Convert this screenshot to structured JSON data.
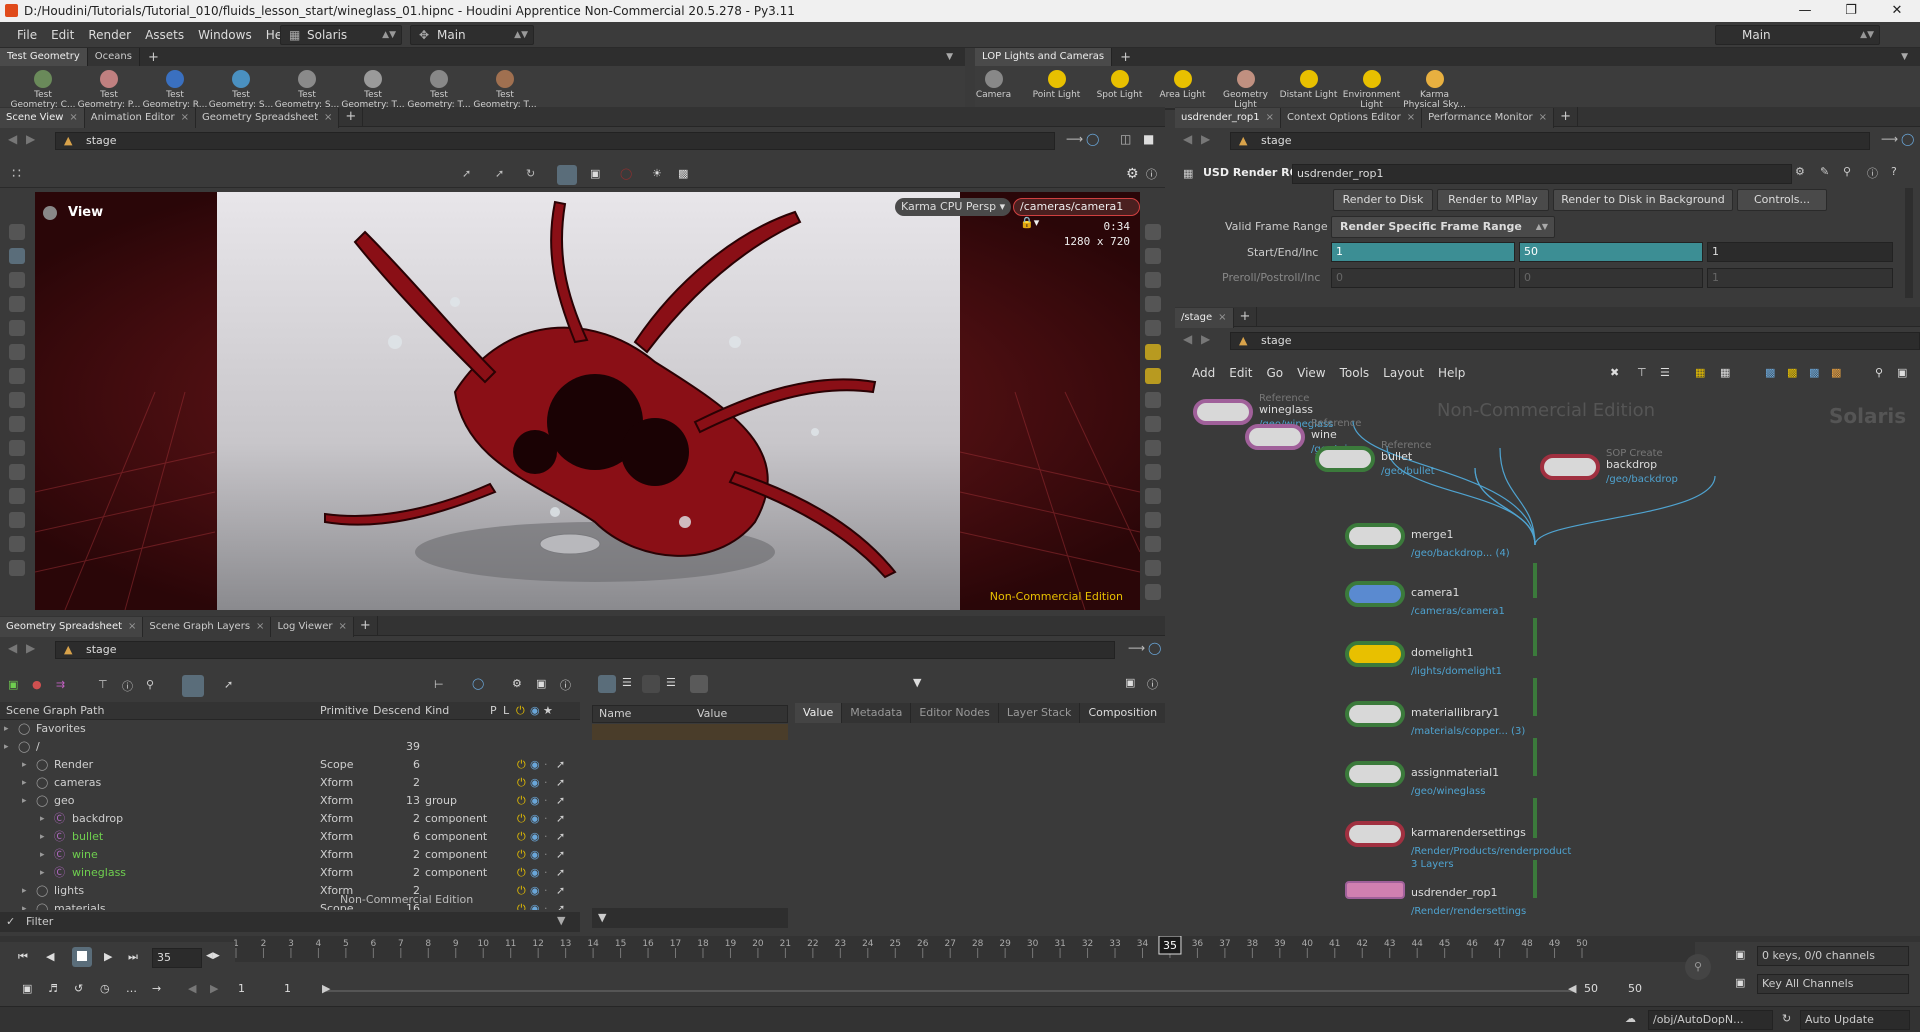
{
  "window": {
    "title": "D:/Houdini/Tutorials/Tutorial_010/fluids_lesson_start/wineglass_01.hipnc - Houdini Apprentice Non-Commercial 20.5.278 - Py3.11"
  },
  "menubar": {
    "items": [
      "File",
      "Edit",
      "Render",
      "Assets",
      "Windows",
      "Help"
    ],
    "desktop_combo": "Solaris",
    "context_combo": "Main",
    "right_combo": "Main"
  },
  "shelf_left": {
    "tabs": [
      "Test Geometry",
      "Oceans"
    ],
    "tools": [
      {
        "label": "Test\nGeometry: C...",
        "icon": "crag-icon"
      },
      {
        "label": "Test\nGeometry: P...",
        "icon": "pig-icon"
      },
      {
        "label": "Test\nGeometry: R...",
        "icon": "rubbertoy-icon"
      },
      {
        "label": "Test\nGeometry: S...",
        "icon": "shaderball-icon"
      },
      {
        "label": "Test\nGeometry: S...",
        "icon": "squab-icon"
      },
      {
        "label": "Test\nGeometry: T...",
        "icon": "template-icon"
      },
      {
        "label": "Test\nGeometry: T...",
        "icon": "tommy-icon"
      },
      {
        "label": "Test\nGeometry: T...",
        "icon": "tube-icon"
      }
    ]
  },
  "shelf_right": {
    "tabs": [
      "LOP Lights and Cameras"
    ],
    "tools": [
      {
        "label": "Camera",
        "icon": "camera-icon"
      },
      {
        "label": "Point Light",
        "icon": "point-light-icon"
      },
      {
        "label": "Spot Light",
        "icon": "spot-light-icon"
      },
      {
        "label": "Area Light",
        "icon": "area-light-icon"
      },
      {
        "label": "Geometry\nLight",
        "icon": "geometry-light-icon"
      },
      {
        "label": "Distant Light",
        "icon": "distant-light-icon"
      },
      {
        "label": "Environment\nLight",
        "icon": "environment-light-icon"
      },
      {
        "label": "Karma\nPhysical Sky...",
        "icon": "karma-sky-icon"
      }
    ]
  },
  "scene_pane": {
    "tabs": [
      "Scene View",
      "Animation Editor",
      "Geometry Spreadsheet"
    ],
    "path": "stage",
    "view_label": "View",
    "renderer": "Karma CPU",
    "projection": "Persp",
    "camera": "/cameras/camera1",
    "render_time": "0:34",
    "resolution": "1280 x 720",
    "watermark": "Non-Commercial Edition"
  },
  "bottom_left_pane": {
    "tabs": [
      "Geometry Spreadsheet",
      "Scene Graph Layers",
      "Log Viewer"
    ],
    "path": "stage",
    "tree_headers": [
      "Scene Graph Path",
      "Primitive",
      "Descend",
      "Kind",
      "P",
      "L"
    ],
    "rows": [
      {
        "name": "Favorites",
        "primitive": "",
        "descend": "",
        "kind": "",
        "indent": 1,
        "color": "normal"
      },
      {
        "name": "/",
        "primitive": "",
        "descend": "39",
        "kind": "",
        "indent": 1,
        "color": "normal"
      },
      {
        "name": "Render",
        "primitive": "Scope",
        "descend": "6",
        "kind": "",
        "indent": 2,
        "color": "normal"
      },
      {
        "name": "cameras",
        "primitive": "Xform",
        "descend": "2",
        "kind": "",
        "indent": 2,
        "color": "normal"
      },
      {
        "name": "geo",
        "primitive": "Xform",
        "descend": "13",
        "kind": "group",
        "indent": 2,
        "color": "normal"
      },
      {
        "name": "backdrop",
        "primitive": "Xform",
        "descend": "2",
        "kind": "component",
        "indent": 3,
        "color": "normal"
      },
      {
        "name": "bullet",
        "primitive": "Xform",
        "descend": "6",
        "kind": "component",
        "indent": 3,
        "color": "green"
      },
      {
        "name": "wine",
        "primitive": "Xform",
        "descend": "2",
        "kind": "component",
        "indent": 3,
        "color": "green"
      },
      {
        "name": "wineglass",
        "primitive": "Xform",
        "descend": "2",
        "kind": "component",
        "indent": 3,
        "color": "green"
      },
      {
        "name": "lights",
        "primitive": "Xform",
        "descend": "2",
        "kind": "",
        "indent": 2,
        "color": "normal"
      },
      {
        "name": "materials",
        "primitive": "Scope",
        "descend": "16",
        "kind": "",
        "indent": 2,
        "color": "normal"
      }
    ],
    "filter_label": "Filter",
    "watermark": "Non-Commercial Edition",
    "attr_headers": [
      "Name",
      "Value"
    ],
    "detail_tabs": [
      "Value",
      "Metadata",
      "Editor Nodes",
      "Layer Stack",
      "Composition"
    ]
  },
  "param_pane": {
    "tabs": [
      "usdrender_rop1",
      "Context Options Editor",
      "Performance Monitor"
    ],
    "path": "stage",
    "node_type": "USD Render ROP",
    "node_name": "usdrender_rop1",
    "buttons": [
      "Render to Disk",
      "Render to MPlay",
      "Render to Disk in Background",
      "Controls..."
    ],
    "valid_frame_range_label": "Valid Frame Range",
    "valid_frame_range_value": "Render Specific Frame Range",
    "start_end_label": "Start/End/Inc",
    "start": "1",
    "end": "50",
    "inc": "1",
    "preroll_label": "Preroll/Postroll/Inc",
    "preroll": [
      "0",
      "0",
      "1"
    ]
  },
  "network_pane": {
    "tab": "/stage",
    "path": "stage",
    "menu": [
      "Add",
      "Edit",
      "Go",
      "View",
      "Tools",
      "Layout",
      "Help"
    ],
    "watermark": "Non-Commercial Edition",
    "context_label": "Solaris",
    "nodes": [
      {
        "name": "wineglass",
        "type": "Reference",
        "sub": "/geo/wineglass"
      },
      {
        "name": "wine",
        "type": "Reference",
        "sub": "/geo/wine"
      },
      {
        "name": "bullet",
        "type": "Reference",
        "sub": "/geo/bullet"
      },
      {
        "name": "backdrop",
        "type": "SOP Create",
        "sub": "/geo/backdrop"
      },
      {
        "name": "merge1",
        "type": "",
        "sub": "/geo/backdrop... (4)"
      },
      {
        "name": "camera1",
        "type": "",
        "sub": "/cameras/camera1"
      },
      {
        "name": "domelight1",
        "type": "",
        "sub": "/lights/domelight1"
      },
      {
        "name": "materiallibrary1",
        "type": "",
        "sub": "/materials/copper... (3)"
      },
      {
        "name": "assignmaterial1",
        "type": "",
        "sub": "/geo/wineglass"
      },
      {
        "name": "karmarendersettings",
        "type": "",
        "sub": "/Render/Products/renderproduct",
        "sub2": "3 Layers"
      },
      {
        "name": "usdrender_rop1",
        "type": "",
        "sub": "/Render/rendersettings"
      }
    ]
  },
  "timeline": {
    "current_frame": "35",
    "ticks": [
      "1",
      "2",
      "3",
      "4",
      "5",
      "6",
      "7",
      "8",
      "9",
      "10",
      "11",
      "12",
      "13",
      "14",
      "15",
      "16",
      "17",
      "18",
      "19",
      "20",
      "21",
      "22",
      "23",
      "24",
      "25",
      "26",
      "27",
      "28",
      "29",
      "30",
      "31",
      "32",
      "33",
      "34",
      "35",
      "36",
      "37",
      "38",
      "39",
      "40",
      "41",
      "42",
      "43",
      "44",
      "45",
      "46",
      "47",
      "48",
      "49",
      "50"
    ],
    "range_start": "1",
    "range_start2": "1",
    "range_end": "50",
    "range_end2": "50",
    "keys_label": "0 keys, 0/0 channels",
    "key_all_label": "Key All Channels"
  },
  "statusbar": {
    "path": "/obj/AutoDopN...",
    "update_mode": "Auto Update"
  },
  "colors": {
    "accent_teal": "#3c8e94",
    "node_green": "#3b7a3b",
    "node_purple": "#a0609a",
    "network_link": "#4fa3d0",
    "watermark_yellow": "#e8c000"
  }
}
